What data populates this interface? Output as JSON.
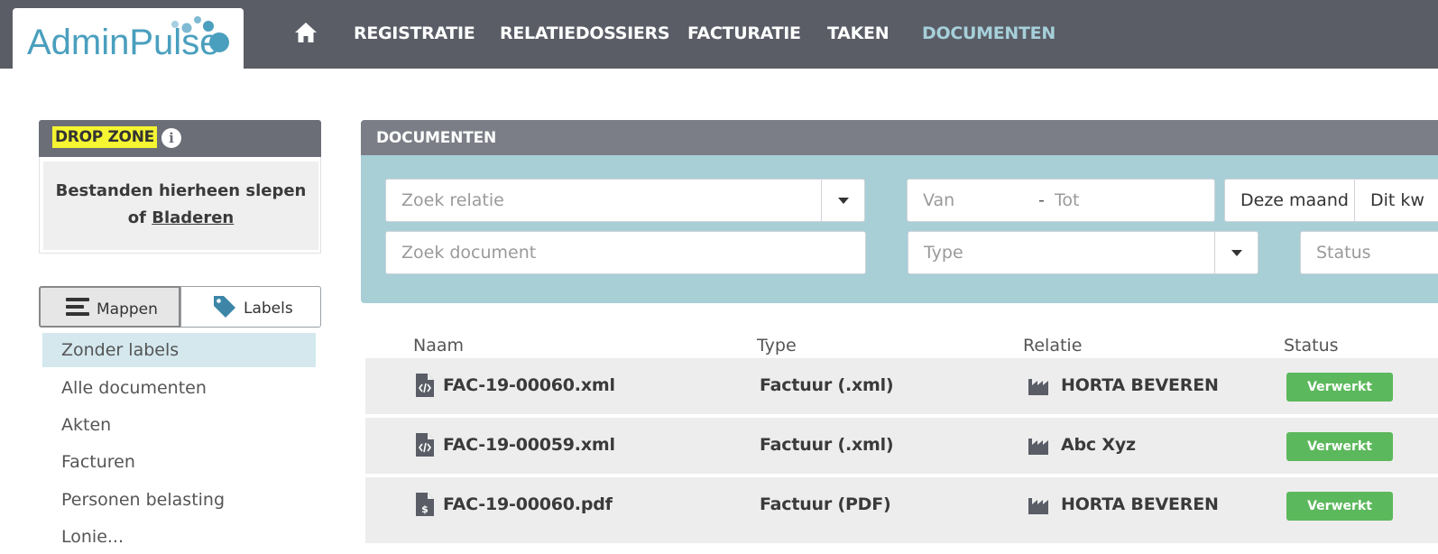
{
  "brand": {
    "name": "AdminPulse"
  },
  "nav": {
    "items": [
      {
        "label": "REGISTRATIE"
      },
      {
        "label": "RELATIEDOSSIERS"
      },
      {
        "label": "FACTURATIE"
      },
      {
        "label": "TAKEN"
      },
      {
        "label": "DOCUMENTEN"
      }
    ],
    "active": "DOCUMENTEN"
  },
  "dropzone": {
    "title": "DROP ZONE",
    "line1": "Bestanden hierheen slepen",
    "line2_prefix": "of",
    "browse_link": "Bladeren"
  },
  "view_toggle": {
    "folders_label": "Mappen",
    "labels_label": "Labels",
    "selected": "Mappen"
  },
  "folders": [
    {
      "label": "Zonder labels",
      "selected": true
    },
    {
      "label": "Alle documenten"
    },
    {
      "label": "Akten"
    },
    {
      "label": "Facturen"
    },
    {
      "label": "Personen belasting"
    },
    {
      "label": "Lonie..."
    }
  ],
  "documents": {
    "title": "DOCUMENTEN",
    "filters": {
      "relation_placeholder": "Zoek relatie",
      "date_from_placeholder": "Van",
      "date_separator": "-",
      "date_to_placeholder": "Tot",
      "period_this_month": "Deze maand",
      "period_this_quarter": "Dit kw",
      "document_placeholder": "Zoek document",
      "type_placeholder": "Type",
      "status_placeholder": "Status"
    },
    "columns": {
      "name": "Naam",
      "type": "Type",
      "relation": "Relatie",
      "status": "Status"
    },
    "rows": [
      {
        "name": "FAC-19-00060.xml",
        "type": "Factuur (.xml)",
        "relation": "HORTA BEVEREN",
        "status": "Verwerkt",
        "file_icon": "file-code-icon"
      },
      {
        "name": "FAC-19-00059.xml",
        "type": "Factuur (.xml)",
        "relation": "Abc Xyz",
        "status": "Verwerkt",
        "file_icon": "file-code-icon"
      },
      {
        "name": "FAC-19-00060.pdf",
        "type": "Factuur (PDF)",
        "relation": "HORTA BEVEREN",
        "status": "Verwerkt",
        "file_icon": "file-invoice-icon"
      }
    ]
  },
  "colors": {
    "topbar": "#5a5d66",
    "brand_blue": "#4a9fbe",
    "active_nav": "#a6d0da",
    "filter_bg": "#a8ced6",
    "status_green": "#5cb85c",
    "highlight": "#f5f532"
  }
}
